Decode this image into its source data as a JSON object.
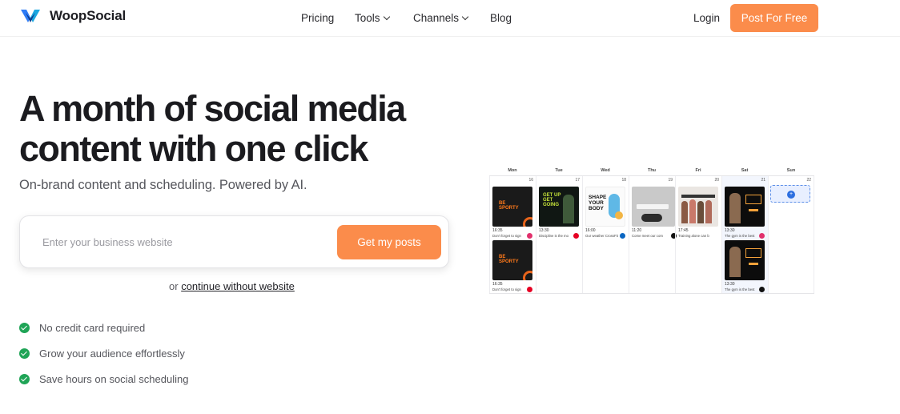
{
  "brand": {
    "name": "WoopSocial",
    "accent": "#fb8c4b"
  },
  "nav": {
    "items": [
      {
        "label": "Pricing",
        "dropdown": false
      },
      {
        "label": "Tools",
        "dropdown": true
      },
      {
        "label": "Channels",
        "dropdown": true
      },
      {
        "label": "Blog",
        "dropdown": false
      }
    ],
    "login": "Login",
    "cta": "Post For Free"
  },
  "hero": {
    "title_line1": "A month of social media",
    "title_line2": "content with one click",
    "subtitle": "On-brand content and scheduling. Powered by AI.",
    "input_placeholder": "Enter your business website",
    "button": "Get my posts",
    "or_text": "or",
    "alt_link": "continue without website"
  },
  "features": [
    "No credit card required",
    "Grow your audience effortlessly",
    "Save hours on social scheduling"
  ],
  "calendar": {
    "days": [
      "Mon",
      "Tue",
      "Wed",
      "Thu",
      "Fri",
      "Sat",
      "Sun"
    ],
    "dates": [
      "16",
      "17",
      "18",
      "19",
      "20",
      "21",
      "22"
    ],
    "posts": {
      "mon1": {
        "time": "16:35",
        "caption": "Don't forget to sign",
        "thumb_text": "BE SPORTY"
      },
      "mon2": {
        "time": "16:35",
        "caption": "Don't forget to sign",
        "thumb_text": "BE SPORTY"
      },
      "tue1": {
        "time": "13:30",
        "caption": "Discipline is the mo",
        "thumb_text": "GET UP GET GOING"
      },
      "wed1": {
        "time": "16:00",
        "caption": "Our weather CrossFit",
        "thumb_text": "SHAPE YOUR BODY"
      },
      "thu1": {
        "time": "11:20",
        "caption": "Come meet our com"
      },
      "fri1": {
        "time": "17:45",
        "caption": "Training alone can b"
      },
      "sat1": {
        "time": "13:30",
        "caption": "The gym is the best"
      },
      "sat2": {
        "time": "13:30",
        "caption": "The gym is the best"
      }
    },
    "sun_add": "+"
  }
}
